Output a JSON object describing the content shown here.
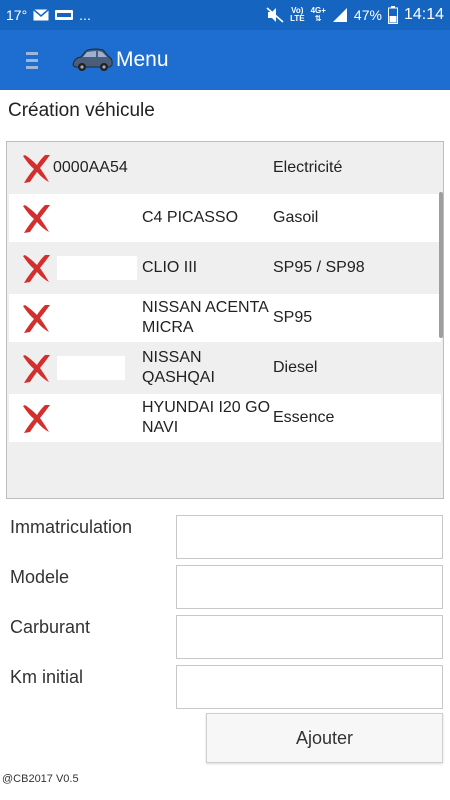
{
  "status": {
    "temp": "17°",
    "dots": "...",
    "net_small_top": "Vo)",
    "net_small_bottom": "LTE",
    "sig_small_top": "4G+",
    "battery": "47%",
    "time": "14:14"
  },
  "appbar": {
    "title": "Menu"
  },
  "section_title": "Création véhicule",
  "vehicles": [
    {
      "plate": "0000AA54",
      "model": "",
      "fuel": "Electricité",
      "redacted": false
    },
    {
      "plate": "",
      "model": "C4 PICASSO",
      "fuel": "Gasoil",
      "redacted": false
    },
    {
      "plate": "",
      "model": "CLIO III",
      "fuel": "SP95 / SP98",
      "redacted": true
    },
    {
      "plate": "",
      "model": "NISSAN ACENTA MICRA",
      "fuel": "SP95",
      "redacted": false
    },
    {
      "plate": "",
      "model": "NISSAN QASHQAI",
      "fuel": "Diesel",
      "redacted": true
    },
    {
      "plate": "",
      "model": "HYUNDAI I20 GO NAVI",
      "fuel": "Essence",
      "redacted": false
    }
  ],
  "form": {
    "immatriculation_label": "Immatriculation",
    "modele_label": "Modele",
    "carburant_label": "Carburant",
    "km_label": "Km initial",
    "immatriculation_value": "",
    "modele_value": "",
    "carburant_value": "",
    "km_value": ""
  },
  "add_button": "Ajouter",
  "footer": "@CB2017 V0.5",
  "colors": {
    "statusbar": "#1565c0",
    "appbar": "#1e6dd0",
    "delete_red": "#d32f2f"
  }
}
